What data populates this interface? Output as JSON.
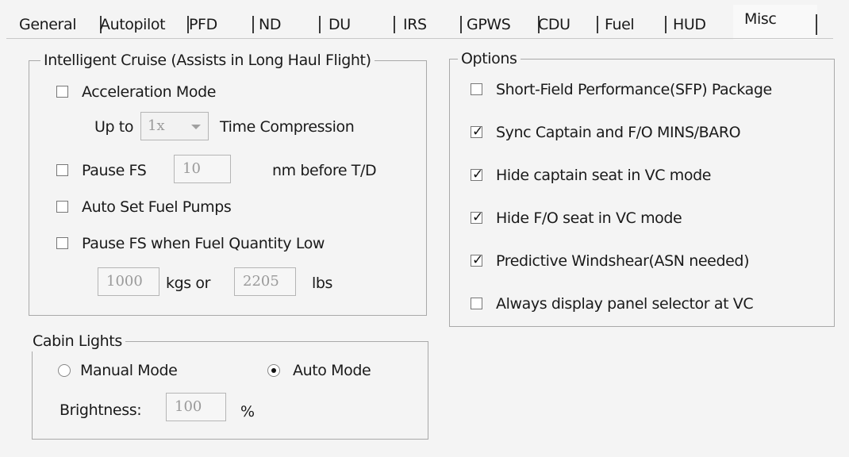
{
  "tabs": [
    "General",
    "Autopilot",
    "PFD",
    "ND",
    "DU",
    "IRS",
    "GPWS",
    "CDU",
    "Fuel",
    "HUD",
    "Misc"
  ],
  "active_tab": "Misc",
  "cruise": {
    "title": "Intelligent Cruise (Assists in Long Haul Flight)",
    "acceleration_label": "Acceleration Mode",
    "acceleration_checked": false,
    "up_to_label": "Up to",
    "compression_value": "1x",
    "time_compression_label": "Time Compression",
    "pause_label": "Pause FS",
    "pause_checked": false,
    "pause_distance": "10",
    "nm_before_label": "nm before T/D",
    "auto_fuel_label": "Auto Set Fuel Pumps",
    "auto_fuel_checked": false,
    "pause_low_label": "Pause FS when Fuel Quantity Low",
    "pause_low_checked": false,
    "kgs_value": "1000",
    "kgs_label": "kgs or",
    "lbs_value": "2205",
    "lbs_label": "lbs"
  },
  "cabin": {
    "title": "Cabin Lights",
    "manual_label": "Manual Mode",
    "auto_label": "Auto Mode",
    "selected": "Auto Mode",
    "brightness_label": "Brightness:",
    "brightness_value": "100",
    "percent_label": "%"
  },
  "options": {
    "title": "Options",
    "items": [
      {
        "label": "Short-Field Performance(SFP) Package",
        "checked": false
      },
      {
        "label": "Sync Captain and F/O MINS/BARO",
        "checked": true
      },
      {
        "label": "Hide captain seat in VC mode",
        "checked": true
      },
      {
        "label": "Hide F/O seat in VC mode",
        "checked": true
      },
      {
        "label": "Predictive Windshear(ASN needed)",
        "checked": true
      },
      {
        "label": "Always display panel selector at VC",
        "checked": false
      }
    ]
  }
}
